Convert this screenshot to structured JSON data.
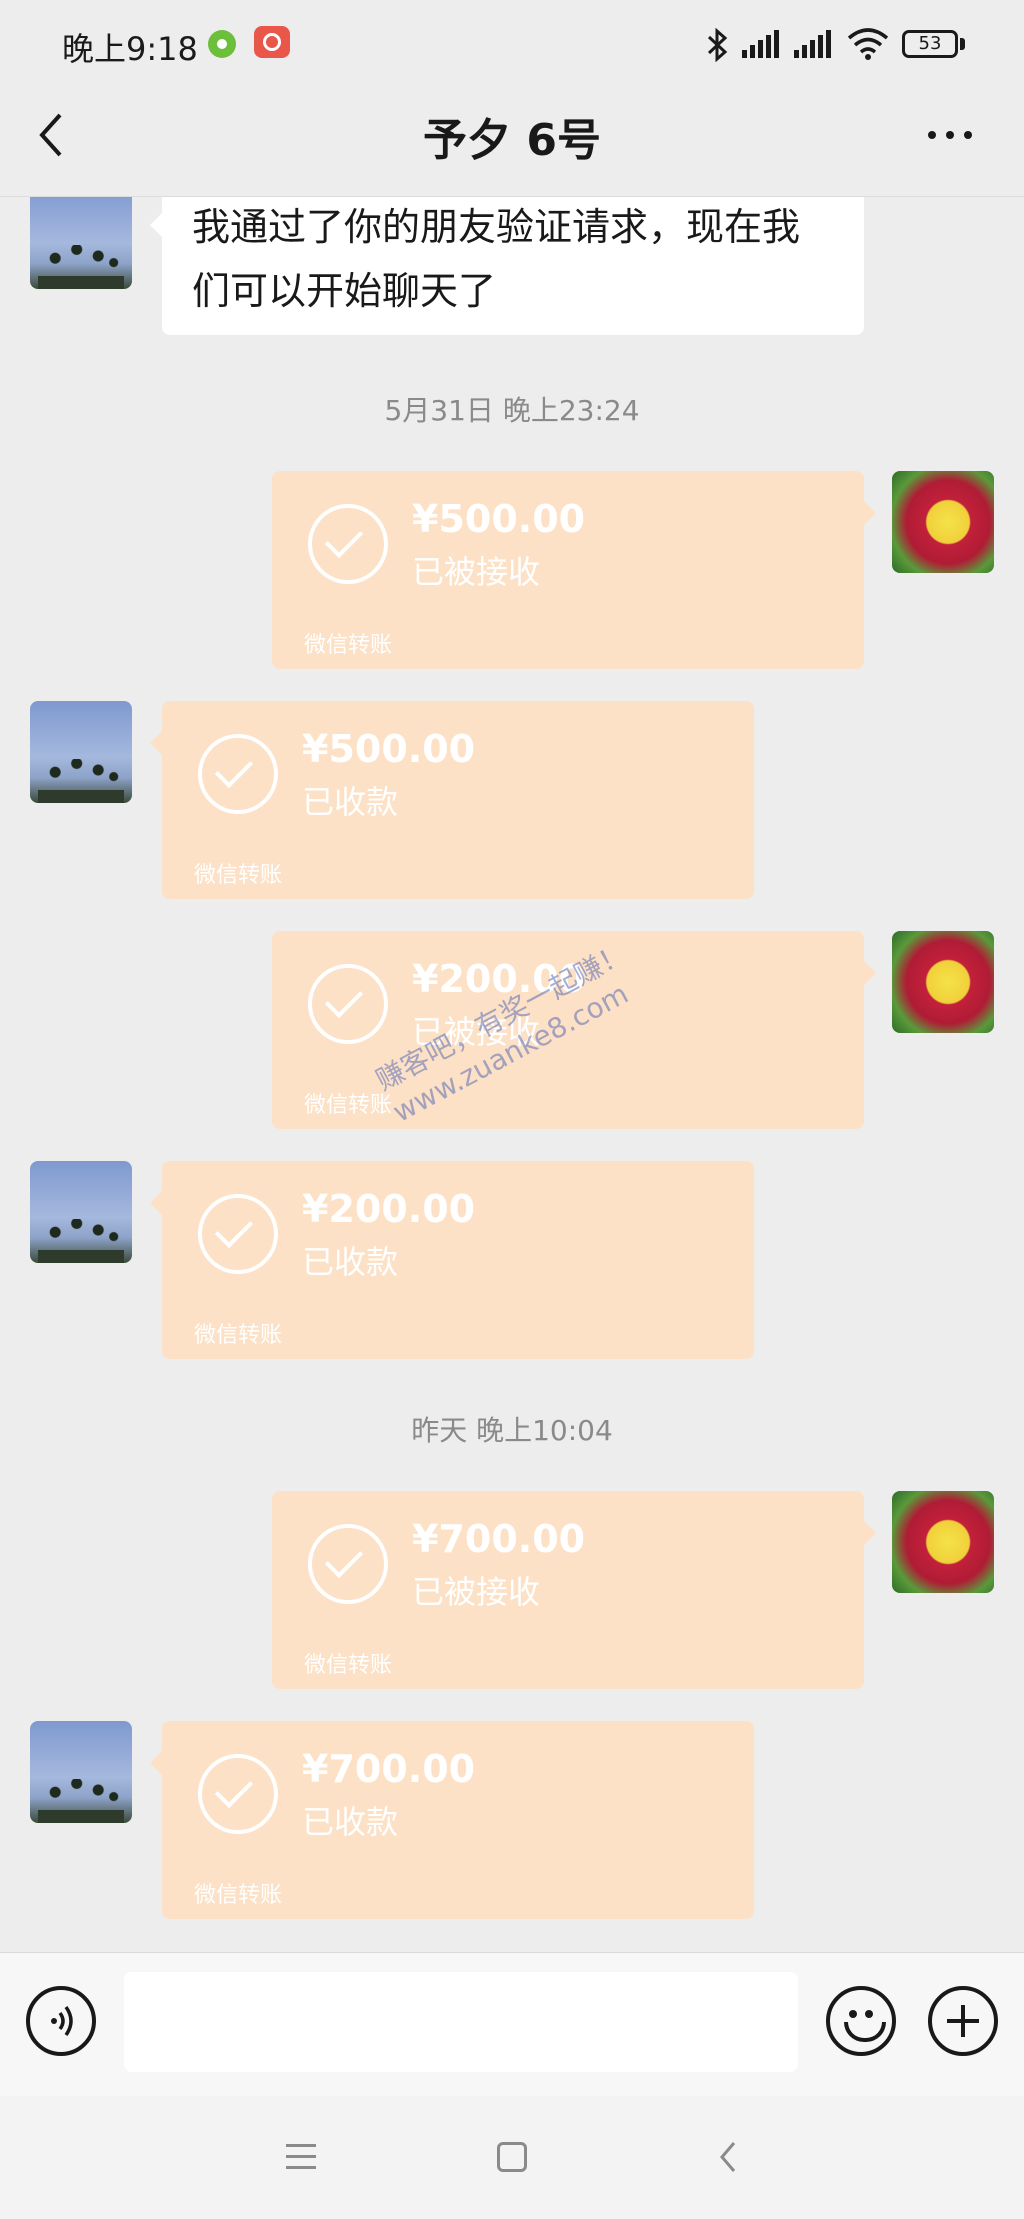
{
  "status_bar": {
    "time": "晚上9:18",
    "battery": "53",
    "icons": [
      "app-icon-green",
      "app-icon-red",
      "bluetooth-icon",
      "signal-icon",
      "signal-icon",
      "wifi-icon",
      "battery-icon"
    ]
  },
  "header": {
    "title": "予夕 6号",
    "back_icon": "chevron-left-icon",
    "more_icon": "more-dots-icon"
  },
  "chat": {
    "first_message": "我通过了你的朋友验证请求，现在我们可以开始聊天了",
    "timestamps": [
      "5月31日 晚上23:24",
      "昨天 晚上10:04"
    ],
    "transfers": [
      {
        "side": "right",
        "amount": "¥500.00",
        "status": "已被接收",
        "footer": "微信转账"
      },
      {
        "side": "left",
        "amount": "¥500.00",
        "status": "已收款",
        "footer": "微信转账"
      },
      {
        "side": "right",
        "amount": "¥200.00",
        "status": "已被接收",
        "footer": "微信转账"
      },
      {
        "side": "left",
        "amount": "¥200.00",
        "status": "已收款",
        "footer": "微信转账"
      },
      {
        "side": "right",
        "amount": "¥700.00",
        "status": "已被接收",
        "footer": "微信转账"
      },
      {
        "side": "left",
        "amount": "¥700.00",
        "status": "已收款",
        "footer": "微信转账"
      }
    ],
    "watermark_line1": "赚客吧，有奖一起赚！",
    "watermark_line2": "www.zuanke8.com"
  },
  "input_bar": {
    "voice_icon": "voice-icon",
    "emoji_icon": "emoji-icon",
    "plus_icon": "plus-icon",
    "message_value": ""
  },
  "nav_bar": {
    "icons": [
      "menu-icon",
      "home-icon",
      "back-icon"
    ]
  },
  "colors": {
    "background": "#ededed",
    "transfer_bubble": "#fde1c6",
    "text_bubble": "#ffffff",
    "timestamp": "#8a8a8a"
  }
}
